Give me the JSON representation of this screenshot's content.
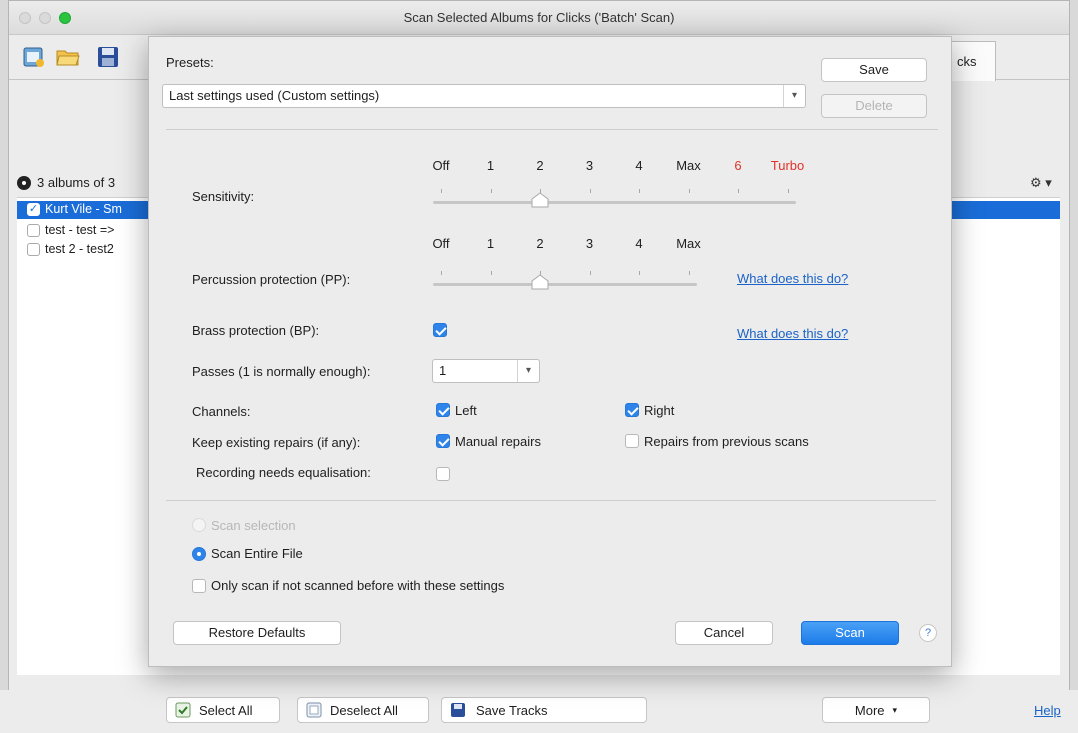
{
  "window": {
    "title": "Scan Selected Albums for Clicks ('Batch' Scan)"
  },
  "main": {
    "tab_partial": "cks",
    "album_count": "3 albums of 3",
    "albums": [
      {
        "label": "Kurt Vile - Sm",
        "checked": true,
        "selected": true
      },
      {
        "label": "test - test =>",
        "checked": false,
        "selected": false
      },
      {
        "label": "test 2 - test2",
        "checked": false,
        "selected": false
      }
    ],
    "gear_label": "⚙ ▾"
  },
  "footer": {
    "select_all": "Select All",
    "deselect_all": "Deselect All",
    "save_tracks": "Save Tracks",
    "more": "More",
    "help": "Help"
  },
  "dialog": {
    "presets_label": "Presets:",
    "preset_value": "Last settings used (Custom settings)",
    "save": "Save",
    "delete": "Delete",
    "sensitivity": {
      "label": "Sensitivity:",
      "ticks": [
        {
          "text": "Off",
          "red": false
        },
        {
          "text": "1",
          "red": false
        },
        {
          "text": "2",
          "red": false
        },
        {
          "text": "3",
          "red": false
        },
        {
          "text": "4",
          "red": false
        },
        {
          "text": "Max",
          "red": false
        },
        {
          "text": "6",
          "red": true
        },
        {
          "text": "Turbo",
          "red": true
        }
      ],
      "value_index": 2
    },
    "percussion": {
      "label": "Percussion protection (PP):",
      "ticks": [
        "Off",
        "1",
        "2",
        "3",
        "4",
        "Max"
      ],
      "value_index": 2,
      "help": "What does this do?"
    },
    "brass": {
      "label": "Brass protection (BP):",
      "checked": true,
      "help": "What does this do?"
    },
    "passes": {
      "label": "Passes (1 is normally enough):",
      "value": "1"
    },
    "channels": {
      "label": "Channels:",
      "left": "Left",
      "right": "Right",
      "left_checked": true,
      "right_checked": true
    },
    "keep_repairs": {
      "label": "Keep existing repairs (if any):",
      "manual": "Manual repairs",
      "previous": "Repairs from previous scans",
      "manual_checked": true,
      "previous_checked": false
    },
    "equalisation": {
      "label": "Recording needs equalisation:",
      "checked": false
    },
    "scan_selection": "Scan selection",
    "scan_entire": "Scan Entire File",
    "only_scan": "Only scan if not scanned before with these settings",
    "restore": "Restore Defaults",
    "cancel": "Cancel",
    "scan": "Scan",
    "help_q": "?"
  },
  "colors": {
    "accent": "#2e84ea",
    "selection": "#1a6dd8",
    "warning_red": "#e0322a",
    "link": "#1c63c7"
  }
}
